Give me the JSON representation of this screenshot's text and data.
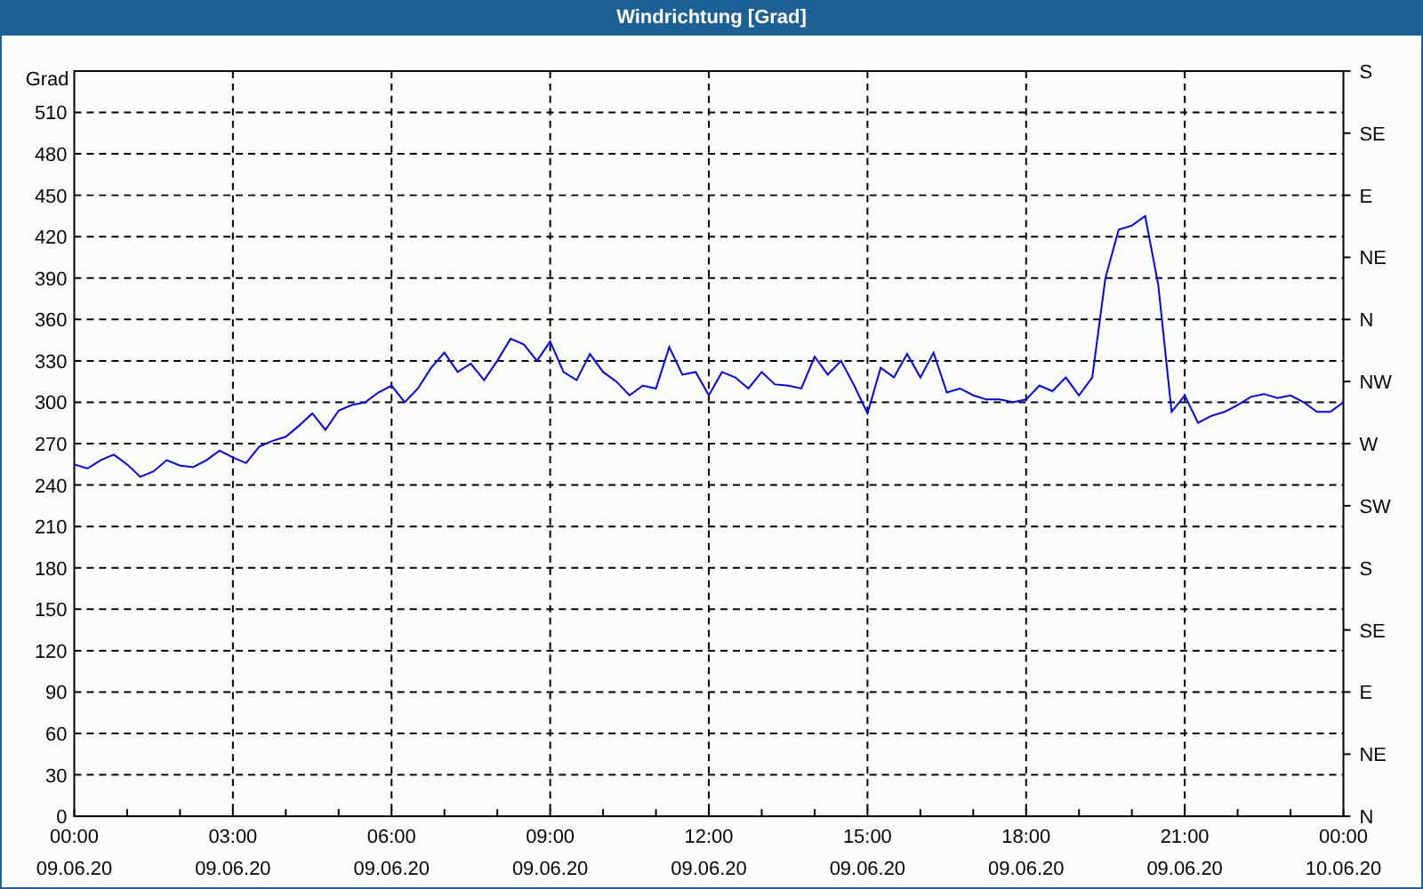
{
  "window": {
    "title": "Windrichtung [Grad]"
  },
  "chart": {
    "right_axis_labels": [
      "S",
      "SE",
      "E",
      "NE",
      "N",
      "NW",
      "W",
      "SW",
      "S",
      "SE",
      "E",
      "NE",
      "N"
    ],
    "chart_data": {
      "type": "line",
      "ylabel": "Grad",
      "ylim": [
        0,
        540
      ],
      "grid": true,
      "categories": [
        "00:00 09.06.20",
        null,
        null,
        null,
        null,
        null,
        null,
        null,
        null,
        null,
        null,
        null,
        "03:00 09.06.20",
        null,
        null,
        null,
        null,
        null,
        null,
        null,
        null,
        null,
        null,
        null,
        "06:00 09.06.20",
        null,
        null,
        null,
        null,
        null,
        null,
        null,
        null,
        null,
        null,
        null,
        "09:00 09.06.20",
        null,
        null,
        null,
        null,
        null,
        null,
        null,
        null,
        null,
        null,
        null,
        "12:00 09.06.20",
        null,
        null,
        null,
        null,
        null,
        null,
        null,
        null,
        null,
        null,
        null,
        "15:00 09.06.20",
        null,
        null,
        null,
        null,
        null,
        null,
        null,
        null,
        null,
        null,
        null,
        "18:00 09.06.20",
        null,
        null,
        null,
        null,
        null,
        null,
        null,
        null,
        null,
        null,
        null,
        "21:00 09.06.20",
        null,
        null,
        null,
        null,
        null,
        null,
        null,
        null,
        null,
        null,
        null,
        "00:00 10.06.20"
      ],
      "yticks": [
        0,
        30,
        60,
        90,
        120,
        150,
        180,
        210,
        240,
        270,
        300,
        330,
        360,
        390,
        420,
        450,
        480,
        510
      ],
      "series": [
        {
          "color": "#0000ff",
          "values": [
            255,
            252,
            258,
            262,
            255,
            246,
            250,
            258,
            254,
            253,
            258,
            265,
            260,
            256,
            268,
            272,
            275,
            283,
            292,
            280,
            294,
            298,
            300,
            307,
            312,
            300,
            310,
            325,
            336,
            322,
            328,
            316,
            330,
            346,
            342,
            330,
            344,
            322,
            316,
            335,
            322,
            315,
            305,
            312,
            310,
            340,
            320,
            322,
            305,
            322,
            318,
            310,
            322,
            313,
            312,
            310,
            333,
            320,
            330,
            312,
            292,
            325,
            318,
            335,
            318,
            336,
            307,
            310,
            305,
            302,
            302,
            300,
            302,
            312,
            308,
            318,
            305,
            318,
            390,
            425,
            428,
            435,
            385,
            293,
            305,
            285,
            290,
            293,
            298,
            304,
            306,
            303,
            305,
            300,
            293,
            293,
            300
          ]
        }
      ]
    }
  }
}
